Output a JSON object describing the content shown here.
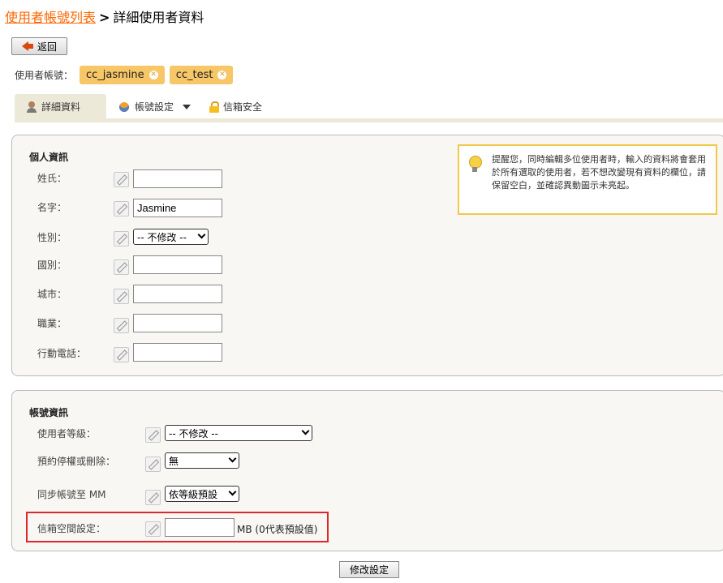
{
  "breadcrumb": {
    "parent": "使用者帳號列表",
    "separator": ">",
    "current": "詳細使用者資料"
  },
  "back_button": {
    "label": "返回"
  },
  "users": {
    "label": "使用者帳號：",
    "tags": [
      "cc_jasmine",
      "cc_test"
    ]
  },
  "tabs": [
    {
      "label": "詳細資料",
      "active": true,
      "icon": "user-icon"
    },
    {
      "label": "帳號設定",
      "active": false,
      "icon": "users-icon",
      "dropdown": true
    },
    {
      "label": "信箱安全",
      "active": false,
      "icon": "lock-icon"
    }
  ],
  "personal": {
    "title": "個人資訊",
    "last_name": {
      "label": "姓氏：",
      "value": ""
    },
    "first_name": {
      "label": "名字：",
      "value": "Jasmine"
    },
    "gender": {
      "label": "性別：",
      "value": "-- 不修改 --"
    },
    "country": {
      "label": "國別：",
      "value": ""
    },
    "city": {
      "label": "城市：",
      "value": ""
    },
    "job": {
      "label": "職業：",
      "value": ""
    },
    "mobile": {
      "label": "行動電話：",
      "value": ""
    }
  },
  "notice": "提醒您，同時編輯多位使用者時，輸入的資料將會套用於所有選取的使用者，若不想改變現有資料的欄位，請保留空白，並確認異動圖示未亮起。",
  "account": {
    "title": "帳號資訊",
    "level": {
      "label": "使用者等級：",
      "value": "-- 不修改 --"
    },
    "suspend": {
      "label": "預約停權或刪除：",
      "value": "無"
    },
    "sync": {
      "label": "同步帳號至 MM",
      "value": "依等級預設"
    },
    "quota": {
      "label": "信箱空間設定：",
      "value": "",
      "suffix": "MB (0代表預設值)"
    }
  },
  "submit": {
    "label": "修改設定"
  },
  "colors": {
    "link": "#ff6600",
    "tag": "#f6c667",
    "panel": "#f8f7f3",
    "highlight": "#e0262a",
    "notice_border": "#f0c84a"
  }
}
